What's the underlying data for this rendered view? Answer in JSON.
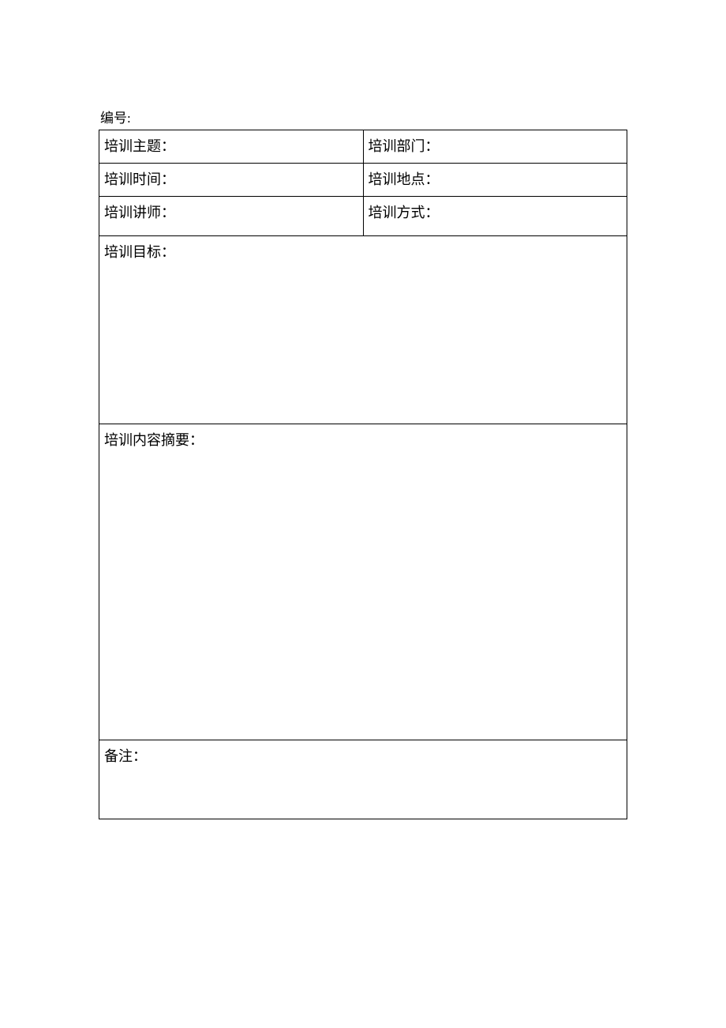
{
  "header": {
    "id_label": "编号:"
  },
  "fields": {
    "topic_label": "培训主题：",
    "department_label": "培训部门：",
    "time_label": "培训时间：",
    "location_label": "培训地点：",
    "instructor_label": "培训讲师：",
    "method_label": "培训方式：",
    "goals_label": "培训目标：",
    "summary_label": "培训内容摘要：",
    "notes_label": "备注："
  }
}
